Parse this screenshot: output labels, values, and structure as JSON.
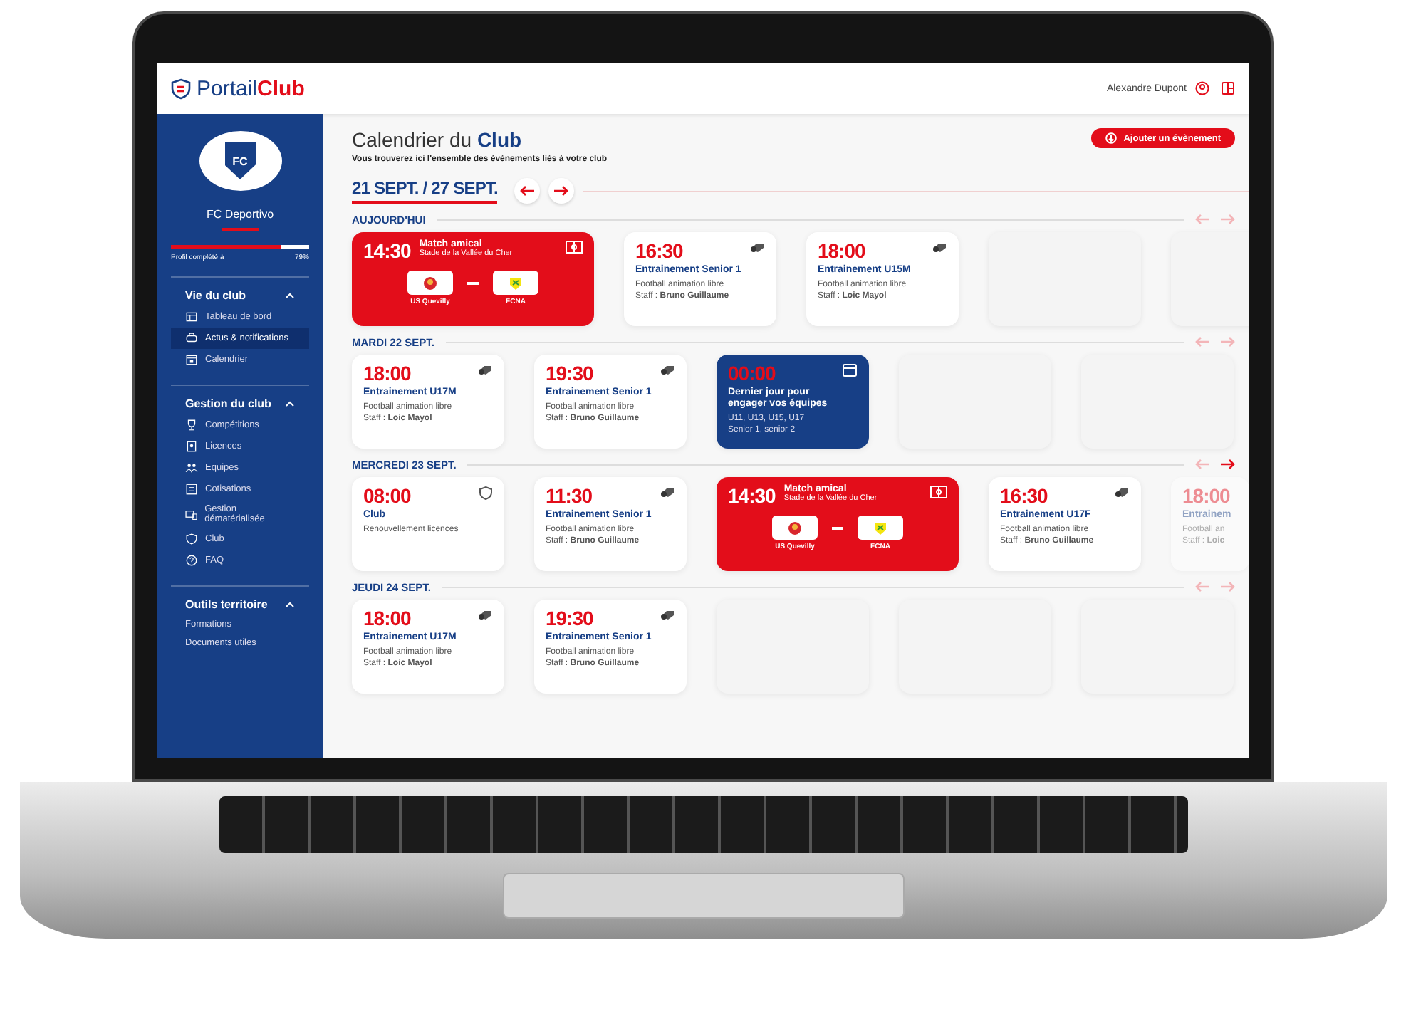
{
  "header": {
    "logo_text": "Portail",
    "logo_accent": "Club",
    "user_name": "Alexandre Dupont"
  },
  "sidebar": {
    "crest_initials": "FC",
    "club_name": "FC Deportivo",
    "profile": {
      "label": "Profil complété à",
      "value": "79%",
      "level": 0.79
    },
    "sections": [
      {
        "title": "Vie du club",
        "expanded": true,
        "items": [
          {
            "label": "Tableau de bord",
            "kind": "icon-link",
            "selected": false
          },
          {
            "label": "Actus & notifications",
            "kind": "icon-link",
            "selected": true
          },
          {
            "label": "Calendrier",
            "kind": "icon-link",
            "selected": false
          }
        ]
      },
      {
        "title": "Gestion du club",
        "expanded": true,
        "items": [
          {
            "label": "Compétitions",
            "kind": "icon-link",
            "selected": false
          },
          {
            "label": "Licences",
            "kind": "icon-link",
            "selected": false
          },
          {
            "label": "Equipes",
            "kind": "icon-link",
            "selected": false
          },
          {
            "label": "Cotisations",
            "kind": "icon-link",
            "selected": false
          },
          {
            "label": "Gestion dématérialisée",
            "kind": "icon-link",
            "selected": false
          },
          {
            "label": "Club",
            "kind": "icon-link",
            "selected": false
          },
          {
            "label": "FAQ",
            "kind": "icon-link",
            "selected": false
          }
        ]
      },
      {
        "title": "Outils territoire",
        "expanded": true,
        "items": [
          {
            "label": "Formations",
            "kind": "text-link",
            "selected": false
          },
          {
            "label": "Documents utiles",
            "kind": "text-link",
            "selected": false
          }
        ]
      }
    ]
  },
  "main": {
    "title": "Calendrier du **Club**",
    "subtitle": "Vous trouverez ici l'ensemble des évènements liés à votre club",
    "add_button": "Ajouter un évènement",
    "week": "21 SEPT. / 27 SEPT.",
    "days": [
      {
        "label": "AUJOURD'HUI",
        "prev_enabled": false,
        "next_enabled": false,
        "events": [
          {
            "kind": "match",
            "time": "14:30",
            "title": "Match amical",
            "venue": "Stade de la Vallée du Cher",
            "home": "US Quevilly",
            "away": "FCNA"
          },
          {
            "kind": "training",
            "time": "16:30",
            "title": "Entrainement Senior 1",
            "desc": "Football animation libre",
            "staff": "Staff : **Bruno Guillaume**",
            "dimmed": false
          },
          {
            "kind": "training",
            "time": "18:00",
            "title": "Entrainement U15M",
            "desc": "Football animation libre",
            "staff": "Staff : **Loic Mayol**",
            "dimmed": false
          },
          {
            "kind": "empty"
          },
          {
            "kind": "empty"
          }
        ]
      },
      {
        "label": "MARDI 22 SEPT.",
        "prev_enabled": false,
        "next_enabled": false,
        "events": [
          {
            "kind": "training",
            "time": "18:00",
            "title": "Entrainement U17M",
            "desc": "Football animation libre",
            "staff": "Staff : **Loic Mayol**",
            "dimmed": false
          },
          {
            "kind": "training",
            "time": "19:30",
            "title": "Entrainement Senior 1",
            "desc": "Football animation libre",
            "staff": "Staff : **Bruno Guillaume**",
            "dimmed": false
          },
          {
            "kind": "deadline",
            "time": "00:00",
            "title": "Dernier jour pour engager vos équipes",
            "lines": [
              "U11, U13, U15, U17",
              "Senior 1, senior 2"
            ]
          },
          {
            "kind": "empty"
          },
          {
            "kind": "empty"
          }
        ]
      },
      {
        "label": "MERCREDI 23 SEPT.",
        "prev_enabled": false,
        "next_enabled": true,
        "events": [
          {
            "kind": "club",
            "time": "08:00",
            "title": "Club",
            "desc": "Renouvellement licences"
          },
          {
            "kind": "training",
            "time": "11:30",
            "title": "Entrainement Senior 1",
            "desc": "Football animation libre",
            "staff": "Staff : **Bruno Guillaume**",
            "dimmed": false
          },
          {
            "kind": "match",
            "time": "14:30",
            "title": "Match amical",
            "venue": "Stade de la Vallée du Cher",
            "home": "US Quevilly",
            "away": "FCNA"
          },
          {
            "kind": "training",
            "time": "16:30",
            "title": "Entrainement U17F",
            "desc": "Football animation libre",
            "staff": "Staff : **Bruno Guillaume**",
            "dimmed": false
          },
          {
            "kind": "training",
            "time": "18:00",
            "title": "Entrainem",
            "desc": "Football an",
            "staff": "Staff : **Loic**",
            "dimmed": true
          }
        ]
      },
      {
        "label": "JEUDI 24 SEPT.",
        "prev_enabled": false,
        "next_enabled": false,
        "events": [
          {
            "kind": "training",
            "time": "18:00",
            "title": "Entrainement U17M",
            "desc": "Football animation libre",
            "staff": "Staff : **Loic Mayol**",
            "dimmed": false
          },
          {
            "kind": "training",
            "time": "19:30",
            "title": "Entrainement Senior 1",
            "desc": "Football animation libre",
            "staff": "Staff : **Bruno Guillaume**",
            "dimmed": false
          },
          {
            "kind": "empty"
          },
          {
            "kind": "empty"
          },
          {
            "kind": "empty"
          }
        ]
      }
    ]
  }
}
